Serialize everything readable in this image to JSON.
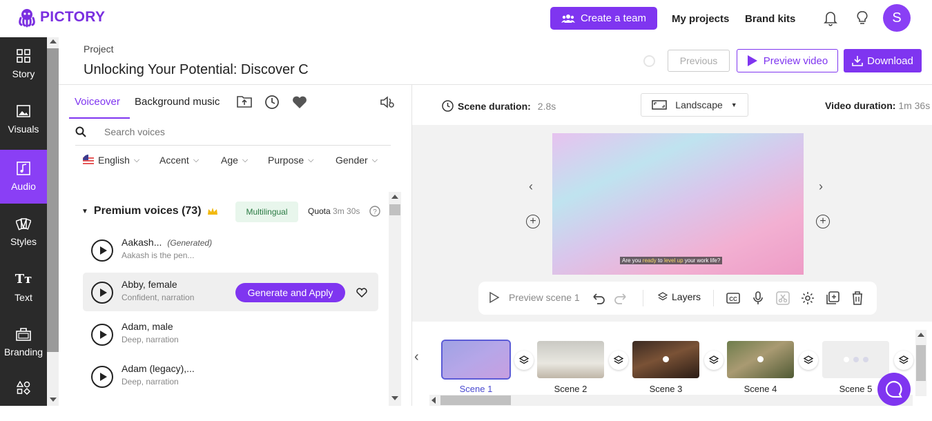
{
  "app": {
    "logo_text": "PICTORY",
    "brand_color": "#7f35f0"
  },
  "topbar": {
    "create_team_label": "Create a team",
    "my_projects_label": "My projects",
    "brand_kits_label": "Brand kits",
    "avatar_initial": "S"
  },
  "sidebar": {
    "items": [
      {
        "label": "Story",
        "icon": "story-icon"
      },
      {
        "label": "Visuals",
        "icon": "visuals-icon"
      },
      {
        "label": "Audio",
        "icon": "audio-icon",
        "active": true
      },
      {
        "label": "Styles",
        "icon": "styles-icon"
      },
      {
        "label": "Text",
        "icon": "text-icon"
      },
      {
        "label": "Branding",
        "icon": "branding-icon"
      },
      {
        "label": "",
        "icon": "elements-icon"
      }
    ]
  },
  "project": {
    "label": "Project",
    "title": "Unlocking Your Potential: Discover C",
    "previous_label": "Previous",
    "preview_label": "Preview video",
    "download_label": "Download"
  },
  "audio_panel": {
    "tabs": [
      "Voiceover",
      "Background music"
    ],
    "active_tab": "Voiceover",
    "search_placeholder": "Search voices",
    "filters": [
      "English",
      "Accent",
      "Age",
      "Purpose",
      "Gender"
    ],
    "section_title": "Premium voices (73)",
    "multilingual_badge": "Multilingual",
    "quota_label": "Quota",
    "quota_value": "3m 30s",
    "voices": [
      {
        "name": "Aakash...",
        "tag": "(Generated)",
        "desc": "Aakash is the pen..."
      },
      {
        "name": "Abby, female",
        "tag": "",
        "desc": "Confident, narration",
        "selected": true,
        "action": "Generate and Apply"
      },
      {
        "name": "Adam, male",
        "tag": "",
        "desc": "Deep, narration"
      },
      {
        "name": "Adam (legacy),...",
        "tag": "",
        "desc": "Deep, narration"
      }
    ]
  },
  "editor": {
    "scene_duration_label": "Scene duration:",
    "scene_duration_value": "2.8s",
    "orientation": "Landscape",
    "video_duration_label": "Video duration:",
    "video_duration_value": "1m 36s",
    "caption_parts": [
      "Are you ",
      "ready",
      " to ",
      "level up",
      " your work life?"
    ],
    "preview_scene_label": "Preview scene 1",
    "layers_label": "Layers"
  },
  "scenes": [
    {
      "label": "Scene 1",
      "selected": true
    },
    {
      "label": "Scene 2"
    },
    {
      "label": "Scene 3"
    },
    {
      "label": "Scene 4"
    },
    {
      "label": "Scene 5"
    }
  ]
}
